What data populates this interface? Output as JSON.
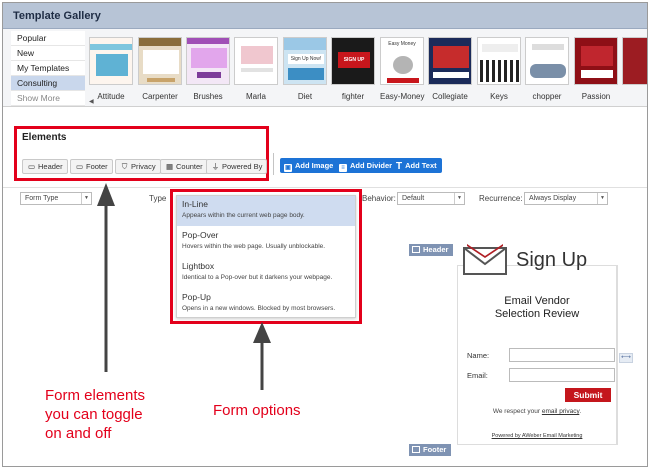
{
  "gallery": {
    "title": "Template Gallery",
    "categories": [
      "Popular",
      "New",
      "My Templates",
      "Consulting",
      "Show More"
    ],
    "active_category": "Consulting",
    "templates": [
      "Attitude",
      "Carpenter",
      "Brushes",
      "Marla",
      "Diet",
      "fighter",
      "Easy-Money",
      "Collegiate",
      "Keys",
      "chopper",
      "Passion"
    ],
    "thumb_texts": {
      "diet": "Sign Up Now!",
      "fighter": "SIGN UP",
      "easy_money": "Easy Money"
    }
  },
  "elements": {
    "title": "Elements",
    "toggles": [
      {
        "label": "Header",
        "icon": "header-icon"
      },
      {
        "label": "Footer",
        "icon": "footer-icon"
      },
      {
        "label": "Privacy",
        "icon": "shield-icon"
      },
      {
        "label": "Counter",
        "icon": "counter-icon"
      },
      {
        "label": "Powered By",
        "icon": "plug-icon"
      }
    ],
    "add_buttons": [
      {
        "label": "Add Image",
        "icon": "image-icon"
      },
      {
        "label": "Add Divider",
        "icon": "divider-icon"
      },
      {
        "label": "Add Text",
        "icon": "text-icon"
      }
    ]
  },
  "toolbar": {
    "form_type": "Form Type",
    "type_label": "Type",
    "behavior_label": "Behavior:",
    "behavior_value": "Default",
    "recurrence_label": "Recurrence:",
    "recurrence_value": "Always Display"
  },
  "form_options": [
    {
      "title": "In-Line",
      "desc": "Appears within the current web page body.",
      "selected": true
    },
    {
      "title": "Pop-Over",
      "desc": "Hovers within the web page. Usually unblockable.",
      "selected": false
    },
    {
      "title": "Lightbox",
      "desc": "Identical to a Pop-over but it darkens your webpage.",
      "selected": false
    },
    {
      "title": "Pop-Up",
      "desc": "Opens in a new windows. Blocked by most browsers.",
      "selected": false
    }
  ],
  "preview": {
    "header_tag": "Header",
    "footer_tag": "Footer",
    "signup_title": "Sign Up",
    "heading_line1": "Email Vendor",
    "heading_line2": "Selection Review",
    "name_label": "Name:",
    "email_label": "Email:",
    "submit": "Submit",
    "respect_text": "We respect your",
    "privacy_link": "email privacy",
    "respect_end": ".",
    "powered_by": "Powered by AWeber Email Marketing"
  },
  "annotations": {
    "left_line1": "Form elements",
    "left_line2": "you can toggle",
    "left_line3": "on and off",
    "right": "Form options"
  },
  "colors": {
    "highlight_red": "#e3001b",
    "accent_blue": "#1d73d6",
    "gallery_header": "#b7c4d6",
    "submit_red": "#c4161c"
  }
}
